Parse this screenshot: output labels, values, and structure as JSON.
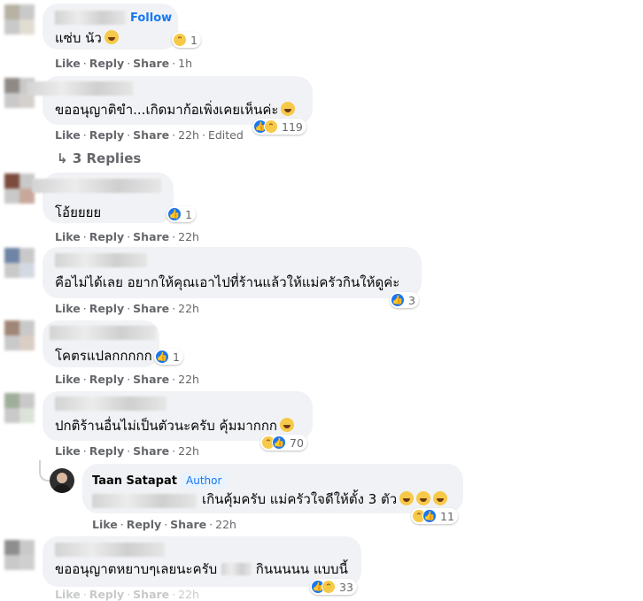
{
  "actions": {
    "like": "Like",
    "reply": "Reply",
    "share": "Share",
    "edited": "Edited"
  },
  "comments": [
    {
      "follow": "Follow",
      "text": "แซ่บ นัว",
      "time": "1h",
      "reaction_count": "1"
    },
    {
      "text": "ขออนุญาติขำ...เกิดมาก้อเพิ่งเคยเห็นค่ะ",
      "time": "22h",
      "reaction_count": "119"
    },
    {
      "text": "โอ้ยยยย",
      "time": "22h",
      "reaction_count": "1"
    },
    {
      "text": "คือไม่ได้เลย อยากให้คุณเอาไปที่ร้านแล้วให้แม่ครัวกินให้ดูค่ะ",
      "time": "22h",
      "reaction_count": "3"
    },
    {
      "text": "โคตรแปลกกกกก",
      "time": "22h",
      "reaction_count": "1"
    },
    {
      "text": "ปกติร้านอื่นไม่เป็นตัวนะครับ คุ้มมากกก",
      "time": "22h",
      "reaction_count": "70"
    },
    {
      "text": "ขออนุญาตหยาบๆเลยนะครับ",
      "text2": "กินนนนน แบบนี้",
      "time": "22h",
      "reaction_count": "33"
    }
  ],
  "replies_link": {
    "icon": "reply-arrow-icon",
    "label": "3 Replies"
  },
  "reply": {
    "author": "Taan Satapat",
    "badge": "Author",
    "text": "เกินคุ้มครับ แม่ครัวใจดีให้ตั้ง 3 ตัว",
    "time": "22h",
    "reaction_count": "11"
  },
  "colors": {
    "bubble": "#f0f2f5",
    "meta": "#65676b",
    "link": "#1877f2",
    "like": "#1877f2",
    "haha": "#f7c948"
  },
  "icons": {
    "like": "like-icon",
    "haha": "haha-icon",
    "emoji": "laughing-emoji-icon"
  }
}
